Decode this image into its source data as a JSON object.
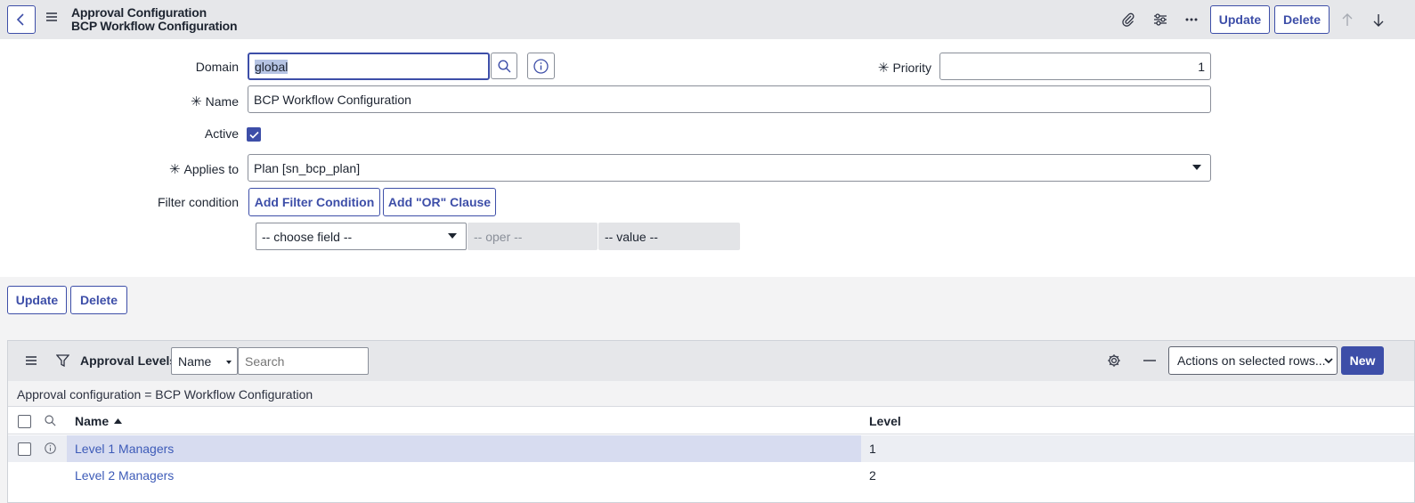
{
  "header": {
    "title_line1": "Approval Configuration",
    "title_line2": "BCP Workflow Configuration",
    "update_label": "Update",
    "delete_label": "Delete"
  },
  "form": {
    "domain_label": "Domain",
    "domain_value": "global",
    "priority_label": "Priority",
    "priority_value": "1",
    "name_label": "Name",
    "name_value": "BCP Workflow Configuration",
    "active_label": "Active",
    "active_checked": true,
    "applies_to_label": "Applies to",
    "applies_to_value": "Plan [sn_bcp_plan]",
    "filter_label": "Filter condition",
    "add_filter_label": "Add Filter Condition",
    "add_or_label": "Add \"OR\" Clause",
    "choose_field": "-- choose field --",
    "oper": "-- oper --",
    "value": "-- value --",
    "required_mark": "✳"
  },
  "form_buttons": {
    "update_label": "Update",
    "delete_label": "Delete"
  },
  "related_list": {
    "title": "Approval Levels",
    "search_field": "Name",
    "search_placeholder": "Search",
    "actions_select": "Actions on selected rows...",
    "new_label": "New",
    "breadcrumb": "Approval configuration = BCP Workflow Configuration",
    "columns": {
      "name": "Name",
      "level": "Level"
    },
    "rows": [
      {
        "name": "Level 1 Managers",
        "level": "1"
      },
      {
        "name": "Level 2 Managers",
        "level": "2"
      }
    ]
  },
  "colors": {
    "accent": "#3d4ea8",
    "header_bg": "#e6e7ea",
    "highlight_row": "#d7dcf0"
  }
}
